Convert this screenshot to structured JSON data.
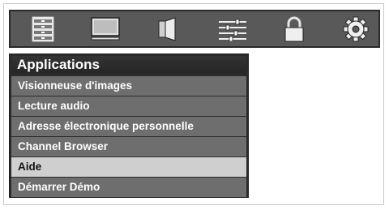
{
  "toolbar": {
    "icons": [
      {
        "name": "list-icon"
      },
      {
        "name": "monitor-icon"
      },
      {
        "name": "speaker-icon"
      },
      {
        "name": "sliders-icon"
      },
      {
        "name": "lock-icon"
      },
      {
        "name": "gear-icon"
      }
    ]
  },
  "menu": {
    "title": "Applications",
    "items": [
      {
        "label": "Visionneuse d'images"
      },
      {
        "label": "Lecture audio"
      },
      {
        "label": "Adresse électronique personnelle"
      },
      {
        "label": "Channel Browser"
      },
      {
        "label": "Aide",
        "selected": true
      },
      {
        "label": "Démarrer Démo"
      }
    ]
  },
  "colors": {
    "toolbar_bg": "#595959",
    "menu_bg": "#2b2b2b",
    "item_bg": "#6e6e6e",
    "selected_bg": "#cfcfcf"
  }
}
